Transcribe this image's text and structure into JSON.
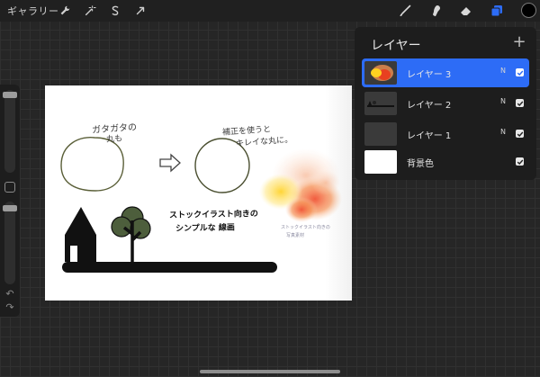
{
  "topbar": {
    "gallery_label": "ギャラリー",
    "left_tools": [
      "wrench-icon",
      "magic-wand-icon",
      "selection-icon",
      "transform-arrow-icon"
    ],
    "right_tools": [
      "brush-icon",
      "smudge-icon",
      "eraser-icon",
      "layers-icon"
    ],
    "active_tool": "layers-icon",
    "current_color": "#000000"
  },
  "sidebar": {
    "brush_size_level": 0.98,
    "opacity_level": 0.95,
    "undo_icon": "undo-icon",
    "redo_icon": "redo-icon"
  },
  "canvas": {
    "note_left_1": "ガタガタの",
    "note_left_2": "丸も",
    "note_right_1": "補正を使うと",
    "note_right_2": "キレイな丸に。",
    "caption_1": "ストックイラスト向きの",
    "caption_2": "シンプルな 線画",
    "watercolor_note_1": "ストックイラスト向きの",
    "watercolor_note_2": "写真素材"
  },
  "layers_panel": {
    "title": "レイヤー",
    "add_icon": "plus-icon",
    "layers": [
      {
        "name": "レイヤー 3",
        "blend": "N",
        "visible": true,
        "active": true
      },
      {
        "name": "レイヤー 2",
        "blend": "N",
        "visible": true,
        "active": false
      },
      {
        "name": "レイヤー 1",
        "blend": "N",
        "visible": true,
        "active": false
      },
      {
        "name": "背景色",
        "blend": "",
        "visible": true,
        "active": false
      }
    ]
  },
  "colors": {
    "accent": "#2d6cf6",
    "canvas_bg": "#ffffff",
    "app_bg": "#262626"
  }
}
